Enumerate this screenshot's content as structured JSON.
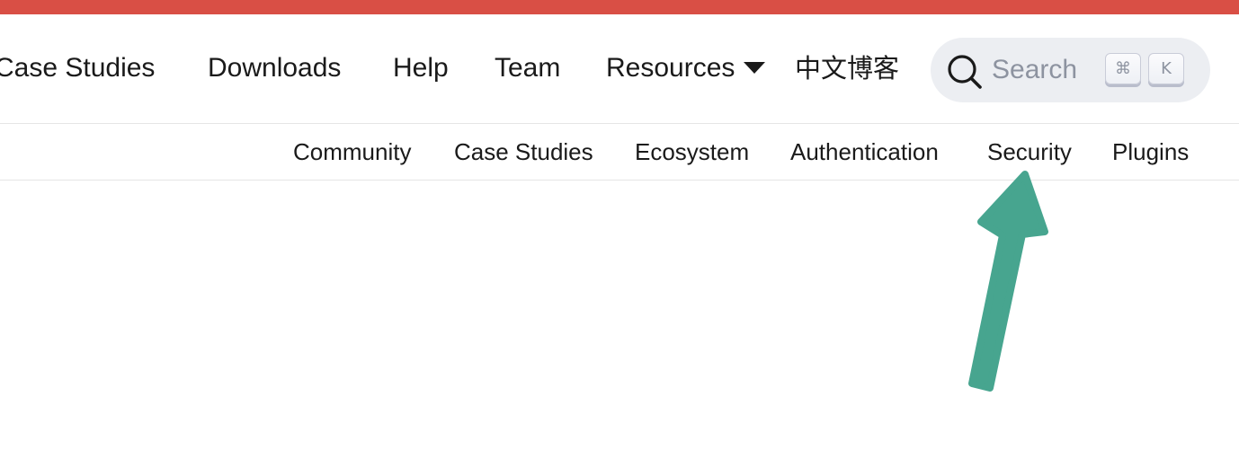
{
  "banner": {
    "color": "#d94f45"
  },
  "nav": {
    "items": [
      "Case Studies",
      "Downloads",
      "Help",
      "Team",
      "Resources"
    ],
    "resources_has_dropdown": true,
    "chinese_blog": "中文博客"
  },
  "search": {
    "placeholder": "Search",
    "shortcut_keys": [
      "⌘",
      "K"
    ]
  },
  "sub_nav": {
    "items": [
      "Community",
      "Case Studies",
      "Ecosystem",
      "Authentication",
      "Security",
      "Plugins"
    ]
  },
  "annotation": {
    "arrow_color": "#47a58f",
    "points_to": "Security"
  }
}
